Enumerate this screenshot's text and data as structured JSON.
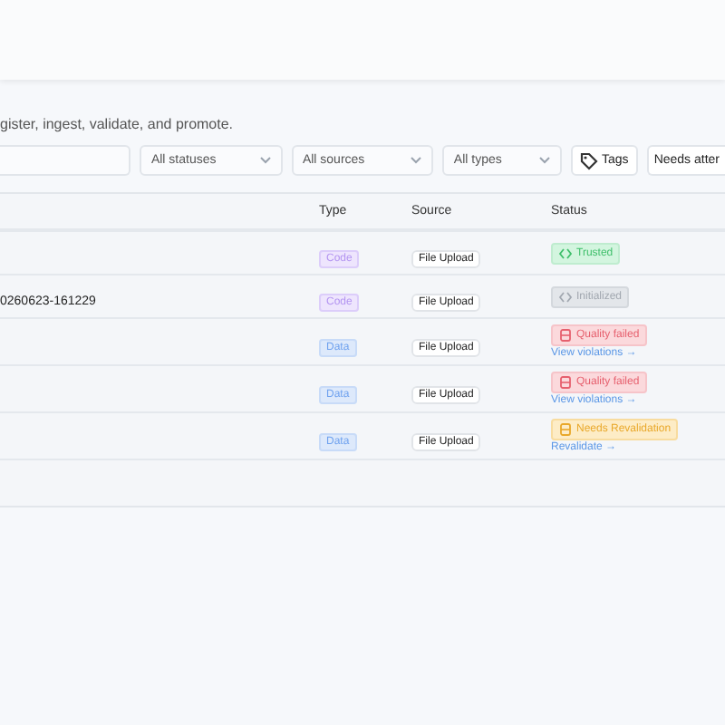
{
  "subtitle": "gister, ingest, validate, and promote.",
  "filters": {
    "selects": [
      "All statuses",
      "All sources",
      "All types"
    ],
    "tags": "Tags",
    "attention": "Needs atter"
  },
  "table": {
    "columns": [
      "Type",
      "Source",
      "Status"
    ],
    "rows": [
      {
        "type": {
          "label": "Code",
          "kind": "code"
        },
        "source": "File Upload",
        "status": {
          "label": "Trusted",
          "kind": "trusted"
        }
      },
      {
        "name": "0260623-161229",
        "type": {
          "label": "Code",
          "kind": "code"
        },
        "source": "File Upload",
        "status": {
          "label": "Initialized",
          "kind": "initialized"
        }
      },
      {
        "type": {
          "label": "Data",
          "kind": "data"
        },
        "source": "File Upload",
        "status": {
          "label": "Quality failed",
          "kind": "failed"
        },
        "action": "View violations →"
      },
      {
        "type": {
          "label": "Data",
          "kind": "data"
        },
        "source": "File Upload",
        "status": {
          "label": "Quality failed",
          "kind": "failed"
        },
        "action": "View violations →"
      },
      {
        "type": {
          "label": "Data",
          "kind": "data"
        },
        "source": "File Upload",
        "status": {
          "label": "Needs Revalidation",
          "kind": "revalidate"
        },
        "action": "Revalidate →"
      }
    ]
  }
}
